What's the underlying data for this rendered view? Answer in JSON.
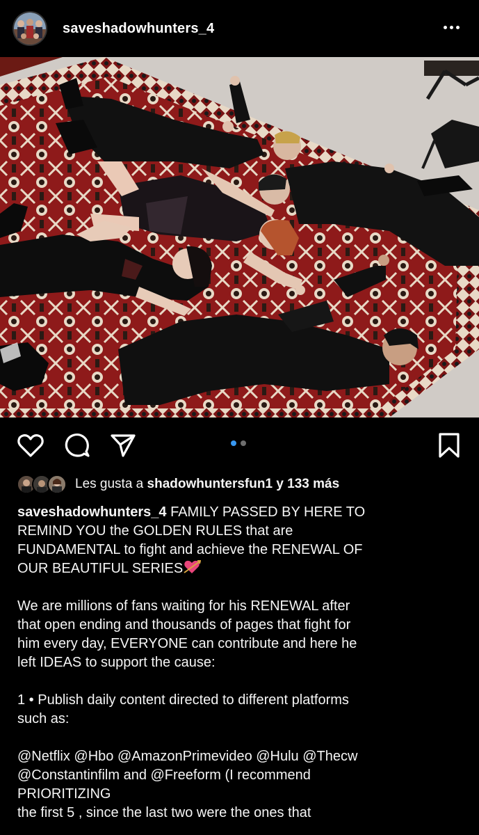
{
  "post": {
    "username": "saveshadowhunters_4",
    "more_icon": "more-horizontal-icon"
  },
  "actions": {
    "like_icon": "heart-outline-icon",
    "comment_icon": "comment-icon",
    "share_icon": "send-icon",
    "save_icon": "bookmark-icon",
    "carousel_pages": 2,
    "carousel_active": 1
  },
  "likes": {
    "prefix": "Les gusta a ",
    "user": "shadowhuntersfun1",
    "suffix": " y 133 más"
  },
  "caption": {
    "author": "saveshadowhunters_4",
    "line1": " FAMILY PASSED BY HERE TO",
    "line2": "REMIND YOU the GOLDEN RULES that are",
    "line3": "FUNDAMENTAL to fight and achieve the RENEWAL OF",
    "line4": "OUR BEAUTIFUL SERIES",
    "heart_emoji": "heart-with-arrow-emoji",
    "p2_line1": "We are millions of fans waiting for his RENEWAL after",
    "p2_line2": "that open ending and thousands of pages that fight for",
    "p2_line3": "him every day, EVERYONE can contribute and here he",
    "p2_line4": "left IDEAS to support the cause:",
    "p3_line1": "1 • Publish daily content directed to different platforms",
    "p3_line2": "such as:",
    "p4_line1": "@Netflix @Hbo @AmazonPrimevideo @Hulu @Thecw",
    "p4_line2": "@Constantinfilm and @Freeform (I recommend",
    "p4_line3": "PRIORITIZING",
    "p4_line4": "the first 5 , since the last two were the ones that"
  },
  "colors": {
    "background": "#000000",
    "text": "#f5f5f5",
    "carousel_active": "#3897f0",
    "carousel_inactive": "#6e6e6e",
    "heart_emoji": "#e8457a"
  }
}
